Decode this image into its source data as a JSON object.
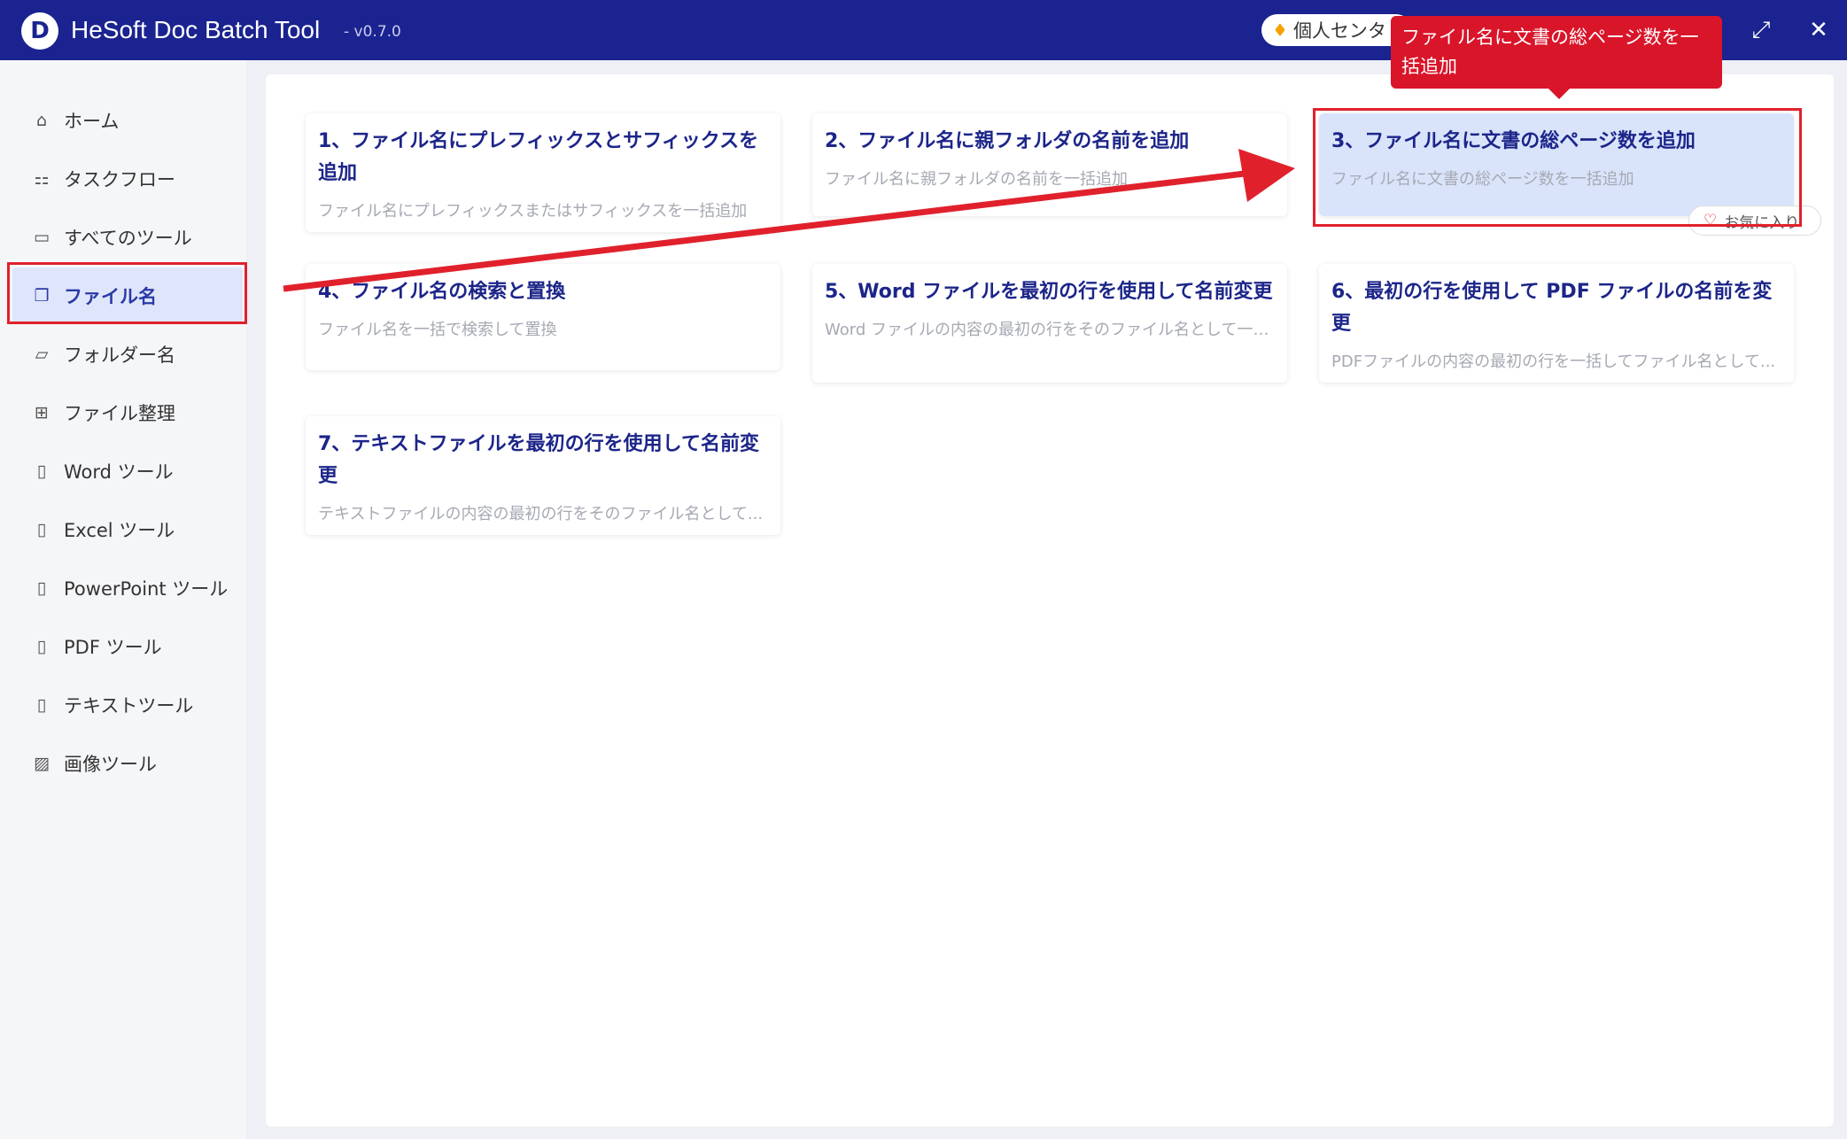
{
  "titlebar": {
    "app_name": "HeSoft Doc Batch Tool",
    "version": "- v0.7.0",
    "logo_letter": "D",
    "user_center": "個人センタ",
    "maximize_glyph": "⤢",
    "close_glyph": "✕"
  },
  "sidebar": {
    "items": [
      {
        "label": "ホーム",
        "icon": "home-icon",
        "glyph": "⌂"
      },
      {
        "label": "タスクフロー",
        "icon": "workflow-icon",
        "glyph": "⚏"
      },
      {
        "label": "すべてのツール",
        "icon": "monitor-icon",
        "glyph": "▭"
      },
      {
        "label": "ファイル名",
        "icon": "file-copy-icon",
        "glyph": "❐",
        "active": true
      },
      {
        "label": "フォルダー名",
        "icon": "folder-icon",
        "glyph": "▱"
      },
      {
        "label": "ファイル整理",
        "icon": "organize-icon",
        "glyph": "⊞"
      },
      {
        "label": "Word ツール",
        "icon": "word-file-icon",
        "glyph": "▯"
      },
      {
        "label": "Excel ツール",
        "icon": "excel-file-icon",
        "glyph": "▯"
      },
      {
        "label": "PowerPoint ツール",
        "icon": "ppt-file-icon",
        "glyph": "▯"
      },
      {
        "label": "PDF ツール",
        "icon": "pdf-file-icon",
        "glyph": "▯"
      },
      {
        "label": "テキストツール",
        "icon": "text-file-icon",
        "glyph": "▯"
      },
      {
        "label": "画像ツール",
        "icon": "image-icon",
        "glyph": "▨"
      }
    ]
  },
  "cards": [
    {
      "title": "1、ファイル名にプレフィックスとサフィックスを追加",
      "desc": "ファイル名にプレフィックスまたはサフィックスを一括追加"
    },
    {
      "title": "2、ファイル名に親フォルダの名前を追加",
      "desc": "ファイル名に親フォルダの名前を一括追加"
    },
    {
      "title": "3、ファイル名に文書の総ページ数を追加",
      "desc": "ファイル名に文書の総ページ数を一括追加"
    },
    {
      "title": "4、ファイル名の検索と置換",
      "desc": "ファイル名を一括で検索して置換"
    },
    {
      "title": "5、Word ファイルを最初の行を使用して名前変更",
      "desc": "Word ファイルの内容の最初の行をそのファイル名として一括..."
    },
    {
      "title": "6、最初の行を使用して PDF ファイルの名前を変更",
      "desc": "PDFファイルの内容の最初の行を一括してファイル名として..."
    },
    {
      "title": "7、テキストファイルを最初の行を使用して名前変更",
      "desc": "テキストファイルの内容の最初の行をそのファイル名として..."
    }
  ],
  "favorite": {
    "label": "お気に入り"
  },
  "tooltip": {
    "text": "ファイル名に文書の総ページ数を一括追加"
  },
  "colors": {
    "accent": "#1a238f",
    "highlight_red": "#e0212c",
    "selected_card": "#d9e4fb"
  }
}
